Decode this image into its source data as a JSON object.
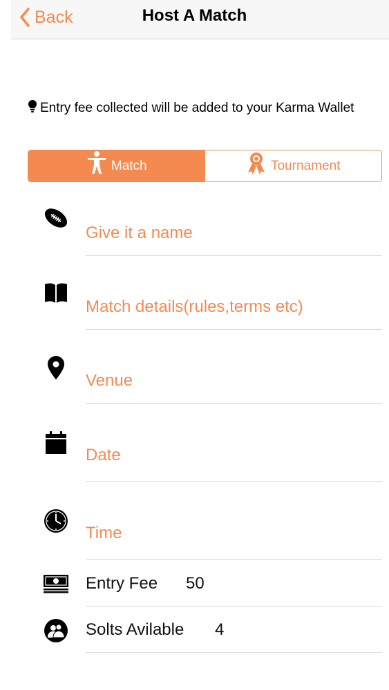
{
  "header": {
    "back_label": "Back",
    "title": "Host A Match"
  },
  "info": {
    "icon": "lightbulb-icon",
    "text": "Entry fee collected will be added to your Karma Wallet"
  },
  "segment": {
    "selected": "Match",
    "accent_color": "#f58a51",
    "options": [
      {
        "label": "Match",
        "icon": "person-icon"
      },
      {
        "label": "Tournament",
        "icon": "award-icon"
      }
    ]
  },
  "form": {
    "name": {
      "placeholder": "Give it a name",
      "icon": "football-icon"
    },
    "details": {
      "placeholder": "Match details(rules,terms etc)",
      "icon": "book-icon"
    },
    "venue": {
      "placeholder": "Venue",
      "icon": "location-pin-icon"
    },
    "date": {
      "placeholder": "Date",
      "icon": "calendar-icon"
    },
    "time": {
      "placeholder": "Time",
      "icon": "clock-icon"
    },
    "entry_fee": {
      "label": "Entry Fee",
      "value": "50",
      "icon": "money-icon"
    },
    "slots": {
      "label": "Solts Avilable",
      "value": "4",
      "icon": "people-icon"
    }
  }
}
